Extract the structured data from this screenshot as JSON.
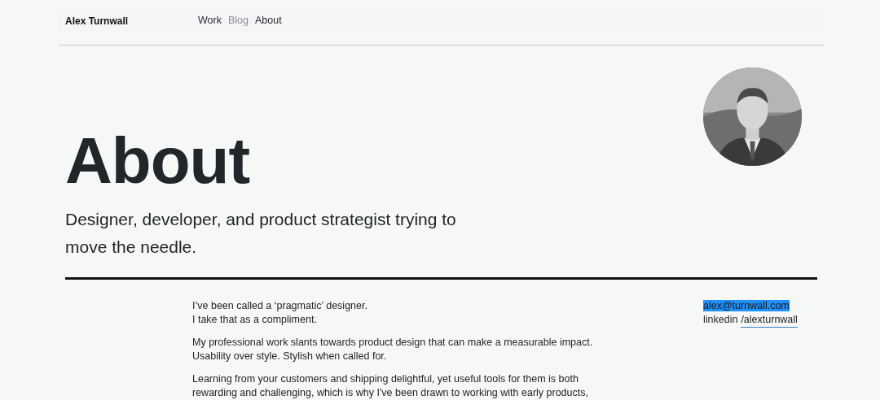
{
  "header": {
    "brand": "Alex Turnwall",
    "nav": [
      {
        "label": "Work",
        "dimmed": false
      },
      {
        "label": "Blog",
        "dimmed": true
      },
      {
        "label": "About",
        "dimmed": false
      }
    ]
  },
  "hero": {
    "title": "About",
    "subtitle": "Designer, developer, and product strategist trying to move the needle."
  },
  "body": {
    "paragraphs": [
      [
        "I’ve been called a ‘pragmatic’ designer.",
        "I take that as a compliment."
      ],
      [
        "My professional work slants towards product design that can make a measurable impact.",
        "Usability over style. Stylish when called for."
      ],
      [
        "Learning from your customers and shipping delightful, yet useful tools for them is both",
        "rewarding and challenging, which is why I've been drawn to working with early products,"
      ]
    ]
  },
  "contact": {
    "email": {
      "text": "alex@turnwall.com",
      "highlighted": true
    },
    "linkedin": {
      "label": "linkedin",
      "link": "/alexturnwall"
    }
  }
}
